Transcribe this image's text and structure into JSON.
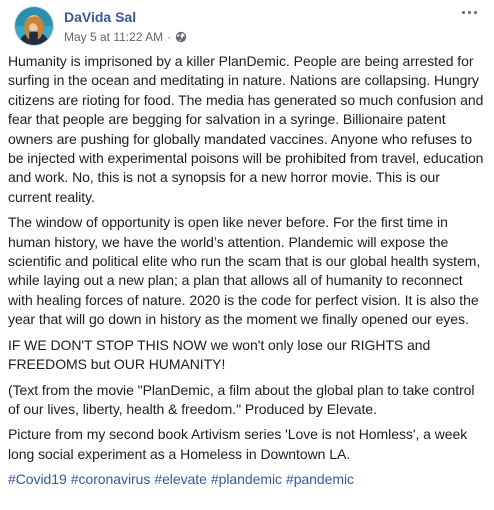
{
  "post": {
    "author": "DaVida Sal",
    "timestamp": "May 5 at 11:22 AM",
    "separator": "·",
    "privacy_icon": "globe-icon",
    "more_icon": "more-horizontal-icon",
    "paragraphs": [
      "Humanity is imprisoned by a killer PlanDemic. People are being arrested for surfing in the ocean and meditating in nature. Nations are collapsing. Hungry citizens are rioting for food. The media has generated so much confusion and fear that people are begging for salvation in a syringe. Billionaire patent owners are pushing for globally mandated vaccines. Anyone who refuses to be injected with experimental poisons will be prohibited from travel, education and work. No, this is not a synopsis for a new horror movie. This is our current reality.",
      "The window of opportunity is open like never before. For the first time in human history, we have the world’s attention. Plandemic will expose the scientific and political elite who run the scam that is our global health system, while laying out a new plan; a plan that allows all of humanity to reconnect with healing forces of nature. 2020 is the code for perfect vision. It is also the year that will go down in history as the moment we finally opened our eyes.",
      "IF WE DON'T STOP THIS NOW we won't only lose our RIGHTS and FREEDOMS but OUR HUMANITY!",
      "(Text from the movie \"PlanDemic, a film about the global plan to take control of our lives, liberty, health & freedom.\" Produced by Elevate.",
      "Picture from my second book Artivism series 'Love is not Homless', a week long social experiment as a Homeless in Downtown LA."
    ],
    "hashtags": [
      "#Covid19",
      "#coronavirus",
      "#elevate",
      "#plandemic",
      "#pandemic"
    ]
  },
  "colors": {
    "author": "#385898",
    "meta": "#606770",
    "text": "#1c1e21",
    "link": "#385898"
  }
}
